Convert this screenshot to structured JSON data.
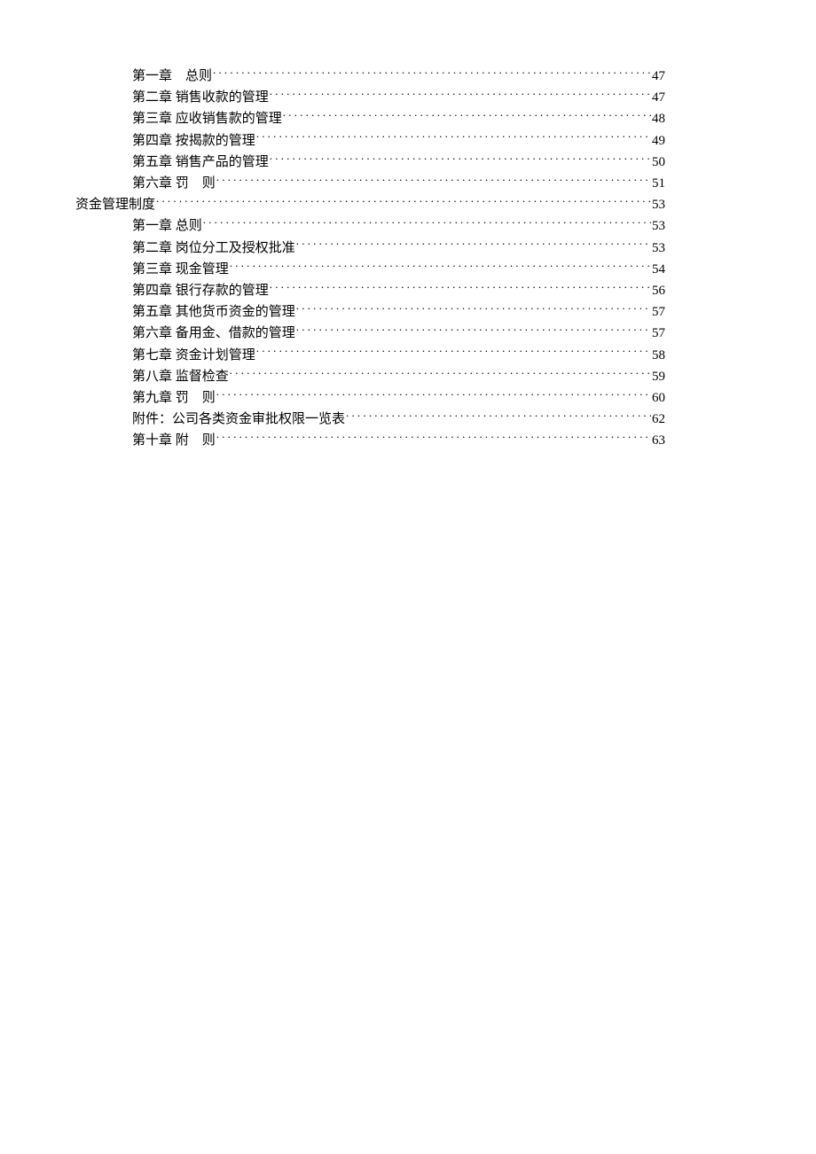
{
  "toc": [
    {
      "indent": 1,
      "label": "第一章　总则",
      "page": "47"
    },
    {
      "indent": 1,
      "label": "第二章 销售收款的管理",
      "page": "47"
    },
    {
      "indent": 1,
      "label": "第三章 应收销售款的管理",
      "page": "48"
    },
    {
      "indent": 1,
      "label": "第四章 按揭款的管理",
      "page": "49"
    },
    {
      "indent": 1,
      "label": "第五章 销售产品的管理",
      "page": "50"
    },
    {
      "indent": 1,
      "label": "第六章 罚　则",
      "page": "51"
    },
    {
      "indent": 0,
      "label": "资金管理制度",
      "page": "53"
    },
    {
      "indent": 1,
      "label": "第一章 总则",
      "page": "53"
    },
    {
      "indent": 1,
      "label": "第二章 岗位分工及授权批准",
      "page": "53"
    },
    {
      "indent": 1,
      "label": "第三章 现金管理",
      "page": "54"
    },
    {
      "indent": 1,
      "label": "第四章 银行存款的管理",
      "page": "56"
    },
    {
      "indent": 1,
      "label": "第五章 其他货币资金的管理",
      "page": "57"
    },
    {
      "indent": 1,
      "label": "第六章 备用金、借款的管理",
      "page": "57"
    },
    {
      "indent": 1,
      "label": "第七章 资金计划管理",
      "page": "58"
    },
    {
      "indent": 1,
      "label": "第八章 监督检查",
      "page": "59"
    },
    {
      "indent": 1,
      "label": "第九章 罚　则",
      "page": "60"
    },
    {
      "indent": 1,
      "label": "附件：公司各类资金审批权限一览表",
      "page": "62"
    },
    {
      "indent": 1,
      "label": "第十章 附　则",
      "page": "63"
    }
  ]
}
